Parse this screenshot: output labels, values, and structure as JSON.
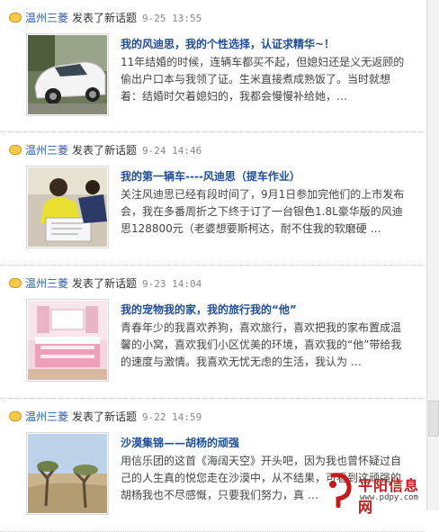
{
  "feed": {
    "entries": [
      {
        "user": "温州三菱",
        "verb": "发表了新话题",
        "time": "9-25 13:55",
        "title": "我的风迪思，我的个性选择，认证求精华~！",
        "body": "11年结婚的时候，连辆车都买不起，但媳妇还是义无返顾的偷出户口本与我领了证。生米直接煮成熟饭了。当时就想着：结婚时欠着媳妇的，我都会慢慢补给她，…",
        "thumb": "white-car-photo"
      },
      {
        "user": "温州三菱",
        "verb": "发表了新话题",
        "time": "9-24 14:46",
        "title": "我的第一辆车----风迪思（提车作业）",
        "body": "关注风迪思已经有段时间了，9月1日参加完他们的上市发布会，我在多番周折之下终于订了一台银色1.8L豪华版的风迪思128800元（老婆想要斯柯达，耐不住我的软磨硬 …",
        "thumb": "signing-contract-photo"
      },
      {
        "user": "温州三菱",
        "verb": "发表了新话题",
        "time": "9-23 14:04",
        "title": "我的宠物我的家，我的旅行我的“他”",
        "body": "青春年少的我喜欢养狗，喜欢旅行，喜欢把我的家布置成温馨的小窝，喜欢我们小区优美的环境，喜欢我的“他”带给我的速度与激情。我喜欢无忧无虑的生活，我认为 …",
        "thumb": "pink-bedroom-photo"
      },
      {
        "user": "温州三菱",
        "verb": "发表了新话题",
        "time": "9-22 14:59",
        "title": "沙漠集锦——胡杨的顽强",
        "body": "用信乐团的这首《海阔天空》开头吧，因为我也曾怀疑过自己的人生真的悦您走在沙漠中，从不结果，可看到这顽强的胡杨我也不尽感慨，只要我们努力，真 …",
        "thumb": "desert-populus-photo"
      }
    ]
  },
  "watermark": {
    "name": "平阳信息网",
    "url": "www.pdpy.com"
  },
  "colors": {
    "link": "#2a5aa8",
    "title": "#1f4e96",
    "time": "#888888",
    "watermark": "#c41a1a"
  }
}
